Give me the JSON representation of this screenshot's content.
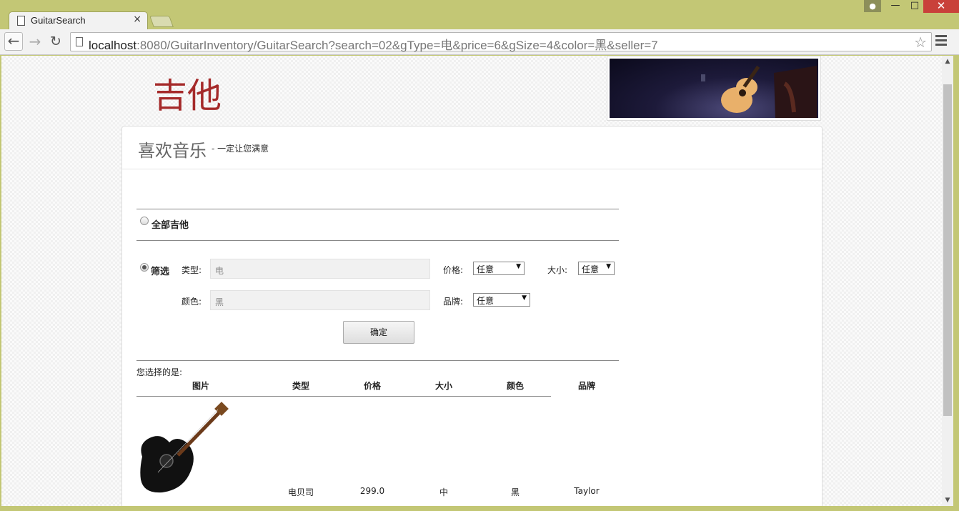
{
  "browser": {
    "tab_title": "GuitarSearch",
    "tab_close": "×",
    "url_host": "localhost",
    "url_rest": ":8080/GuitarInventory/GuitarSearch?search=02&gType=电&price=6&gSize=4&color=黑&seller=7"
  },
  "header": {
    "logo_text": "吉他"
  },
  "panel": {
    "title": "喜欢音乐",
    "subtitle": "- 一定让您满意"
  },
  "filters": {
    "all_label": "全部吉他",
    "filter_label": "筛选",
    "type_label": "类型:",
    "type_placeholder": "电",
    "price_label": "价格:",
    "price_value": "任意",
    "size_label": "大小:",
    "size_value": "任意",
    "color_label": "颜色:",
    "color_placeholder": "黑",
    "brand_label": "品牌:",
    "brand_value": "任意",
    "submit_label": "确定"
  },
  "results": {
    "label": "您选择的是:",
    "columns": [
      "图片",
      "类型",
      "价格",
      "大小",
      "颜色",
      "品牌"
    ],
    "rows": [
      {
        "type": "电贝司",
        "price": "299.0",
        "size": "中",
        "color": "黑",
        "brand": "Taylor"
      }
    ]
  },
  "colors": {
    "logo": "#a52a2a",
    "frame": "#c3c775",
    "close_button": "#c9413a"
  }
}
